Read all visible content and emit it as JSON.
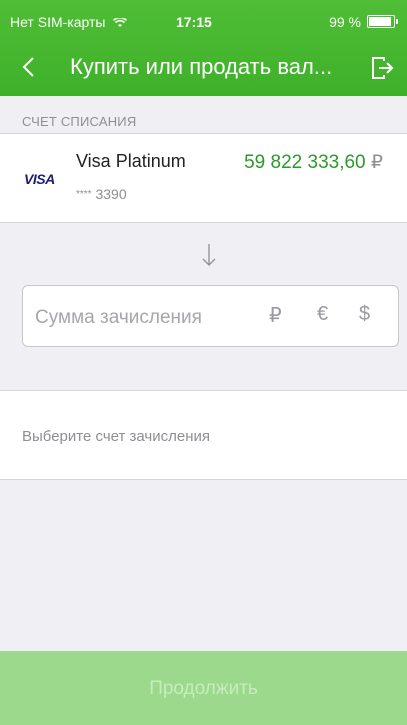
{
  "status_bar": {
    "carrier": "Нет SIM-карты",
    "time": "17:15",
    "battery": "99 %"
  },
  "nav": {
    "title": "Купить или продать вал...",
    "back_icon": "chevron-left-icon",
    "exit_icon": "logout-icon"
  },
  "debit_account": {
    "section_label": "СЧЕТ СПИСАНИЯ",
    "card_brand": "VISA",
    "name": "Visa Platinum",
    "number_mask": "****",
    "number_last4": "3390",
    "balance": "59 822 333,60",
    "currency_symbol": "₽"
  },
  "amount": {
    "placeholder": "Сумма зачисления",
    "currencies": [
      "₽",
      "€",
      "$"
    ]
  },
  "credit_account": {
    "placeholder": "Выберите счет зачисления"
  },
  "footer": {
    "continue_label": "Продолжить"
  },
  "colors": {
    "header_green": "#3fb02a",
    "balance_green": "#2a9a2a",
    "button_disabled": "#9cd98c",
    "background": "#efeff4"
  }
}
